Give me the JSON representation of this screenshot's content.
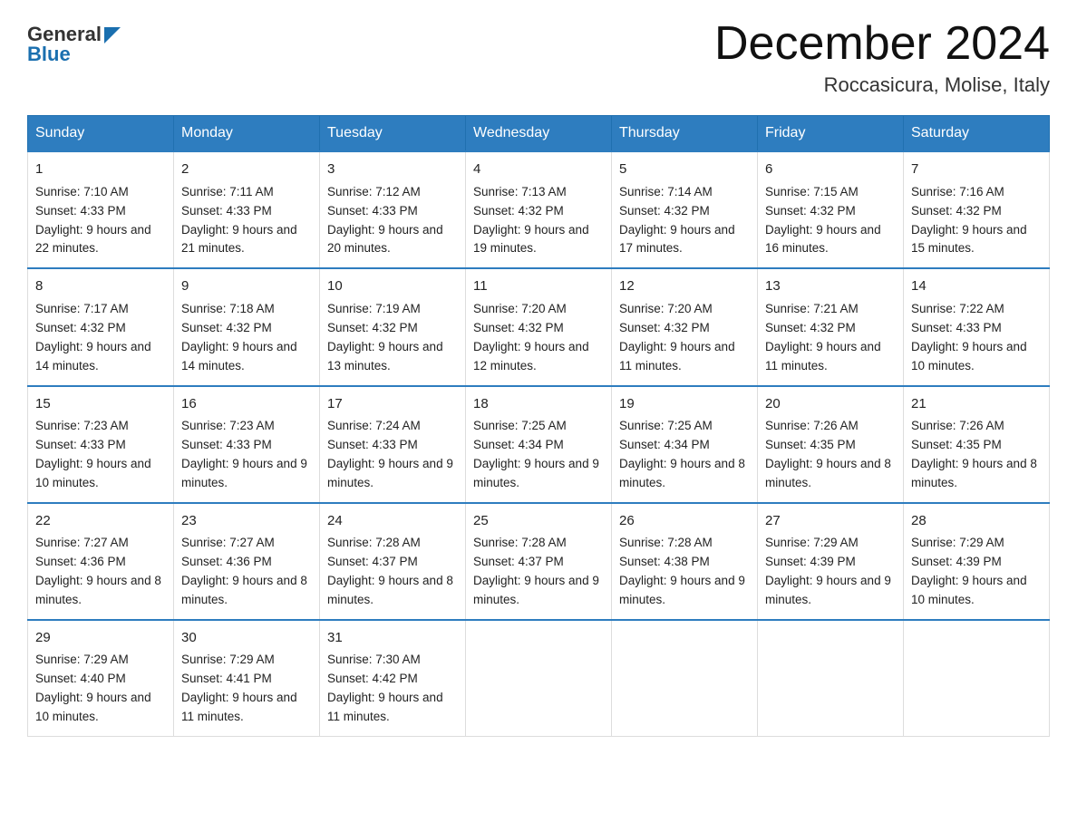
{
  "header": {
    "logo": {
      "text_general": "General",
      "text_blue": "Blue"
    },
    "month_title": "December 2024",
    "location": "Roccasicura, Molise, Italy"
  },
  "weekdays": [
    "Sunday",
    "Monday",
    "Tuesday",
    "Wednesday",
    "Thursday",
    "Friday",
    "Saturday"
  ],
  "weeks": [
    [
      {
        "day": "1",
        "sunrise": "7:10 AM",
        "sunset": "4:33 PM",
        "daylight": "9 hours and 22 minutes."
      },
      {
        "day": "2",
        "sunrise": "7:11 AM",
        "sunset": "4:33 PM",
        "daylight": "9 hours and 21 minutes."
      },
      {
        "day": "3",
        "sunrise": "7:12 AM",
        "sunset": "4:33 PM",
        "daylight": "9 hours and 20 minutes."
      },
      {
        "day": "4",
        "sunrise": "7:13 AM",
        "sunset": "4:32 PM",
        "daylight": "9 hours and 19 minutes."
      },
      {
        "day": "5",
        "sunrise": "7:14 AM",
        "sunset": "4:32 PM",
        "daylight": "9 hours and 17 minutes."
      },
      {
        "day": "6",
        "sunrise": "7:15 AM",
        "sunset": "4:32 PM",
        "daylight": "9 hours and 16 minutes."
      },
      {
        "day": "7",
        "sunrise": "7:16 AM",
        "sunset": "4:32 PM",
        "daylight": "9 hours and 15 minutes."
      }
    ],
    [
      {
        "day": "8",
        "sunrise": "7:17 AM",
        "sunset": "4:32 PM",
        "daylight": "9 hours and 14 minutes."
      },
      {
        "day": "9",
        "sunrise": "7:18 AM",
        "sunset": "4:32 PM",
        "daylight": "9 hours and 14 minutes."
      },
      {
        "day": "10",
        "sunrise": "7:19 AM",
        "sunset": "4:32 PM",
        "daylight": "9 hours and 13 minutes."
      },
      {
        "day": "11",
        "sunrise": "7:20 AM",
        "sunset": "4:32 PM",
        "daylight": "9 hours and 12 minutes."
      },
      {
        "day": "12",
        "sunrise": "7:20 AM",
        "sunset": "4:32 PM",
        "daylight": "9 hours and 11 minutes."
      },
      {
        "day": "13",
        "sunrise": "7:21 AM",
        "sunset": "4:32 PM",
        "daylight": "9 hours and 11 minutes."
      },
      {
        "day": "14",
        "sunrise": "7:22 AM",
        "sunset": "4:33 PM",
        "daylight": "9 hours and 10 minutes."
      }
    ],
    [
      {
        "day": "15",
        "sunrise": "7:23 AM",
        "sunset": "4:33 PM",
        "daylight": "9 hours and 10 minutes."
      },
      {
        "day": "16",
        "sunrise": "7:23 AM",
        "sunset": "4:33 PM",
        "daylight": "9 hours and 9 minutes."
      },
      {
        "day": "17",
        "sunrise": "7:24 AM",
        "sunset": "4:33 PM",
        "daylight": "9 hours and 9 minutes."
      },
      {
        "day": "18",
        "sunrise": "7:25 AM",
        "sunset": "4:34 PM",
        "daylight": "9 hours and 9 minutes."
      },
      {
        "day": "19",
        "sunrise": "7:25 AM",
        "sunset": "4:34 PM",
        "daylight": "9 hours and 8 minutes."
      },
      {
        "day": "20",
        "sunrise": "7:26 AM",
        "sunset": "4:35 PM",
        "daylight": "9 hours and 8 minutes."
      },
      {
        "day": "21",
        "sunrise": "7:26 AM",
        "sunset": "4:35 PM",
        "daylight": "9 hours and 8 minutes."
      }
    ],
    [
      {
        "day": "22",
        "sunrise": "7:27 AM",
        "sunset": "4:36 PM",
        "daylight": "9 hours and 8 minutes."
      },
      {
        "day": "23",
        "sunrise": "7:27 AM",
        "sunset": "4:36 PM",
        "daylight": "9 hours and 8 minutes."
      },
      {
        "day": "24",
        "sunrise": "7:28 AM",
        "sunset": "4:37 PM",
        "daylight": "9 hours and 8 minutes."
      },
      {
        "day": "25",
        "sunrise": "7:28 AM",
        "sunset": "4:37 PM",
        "daylight": "9 hours and 9 minutes."
      },
      {
        "day": "26",
        "sunrise": "7:28 AM",
        "sunset": "4:38 PM",
        "daylight": "9 hours and 9 minutes."
      },
      {
        "day": "27",
        "sunrise": "7:29 AM",
        "sunset": "4:39 PM",
        "daylight": "9 hours and 9 minutes."
      },
      {
        "day": "28",
        "sunrise": "7:29 AM",
        "sunset": "4:39 PM",
        "daylight": "9 hours and 10 minutes."
      }
    ],
    [
      {
        "day": "29",
        "sunrise": "7:29 AM",
        "sunset": "4:40 PM",
        "daylight": "9 hours and 10 minutes."
      },
      {
        "day": "30",
        "sunrise": "7:29 AM",
        "sunset": "4:41 PM",
        "daylight": "9 hours and 11 minutes."
      },
      {
        "day": "31",
        "sunrise": "7:30 AM",
        "sunset": "4:42 PM",
        "daylight": "9 hours and 11 minutes."
      },
      null,
      null,
      null,
      null
    ]
  ]
}
